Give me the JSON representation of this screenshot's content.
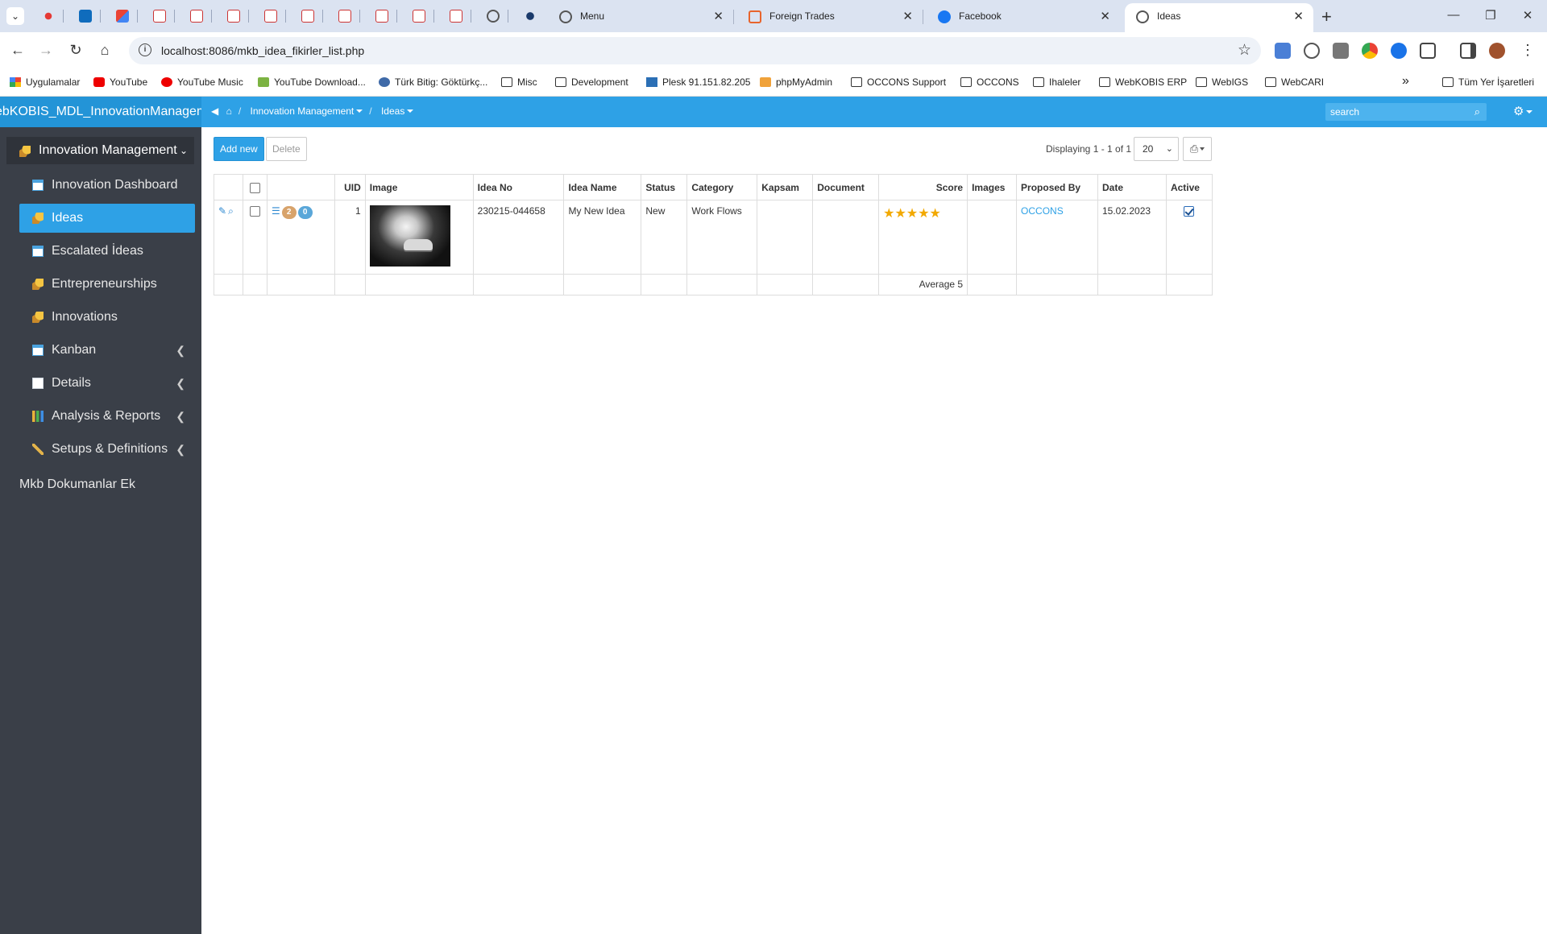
{
  "browser": {
    "tabs": [
      {
        "title": "Menu"
      },
      {
        "title": "Foreign Trades"
      },
      {
        "title": "Facebook"
      },
      {
        "title": "Ideas",
        "active": true
      }
    ],
    "url": "localhost:8086/mkb_idea_fikirler_list.php",
    "bookmarks": [
      {
        "label": "Uygulamalar",
        "icon": "apps-grid-icon"
      },
      {
        "label": "YouTube",
        "icon": "youtube-icon"
      },
      {
        "label": "YouTube Music",
        "icon": "youtube-music-icon"
      },
      {
        "label": "YouTube Download...",
        "icon": "download-icon"
      },
      {
        "label": "Türk Bitig: Göktürkç...",
        "icon": "site-icon"
      },
      {
        "label": "Misc",
        "icon": "folder-icon"
      },
      {
        "label": "Development",
        "icon": "folder-icon"
      },
      {
        "label": "Plesk 91.151.82.205",
        "icon": "plesk-icon"
      },
      {
        "label": "phpMyAdmin",
        "icon": "phpmyadmin-icon"
      },
      {
        "label": "OCCONS Support",
        "icon": "folder-icon"
      },
      {
        "label": "OCCONS",
        "icon": "folder-icon"
      },
      {
        "label": "Ihaleler",
        "icon": "folder-icon"
      },
      {
        "label": "WebKOBIS ERP",
        "icon": "folder-icon"
      },
      {
        "label": "WebIGS",
        "icon": "folder-icon"
      },
      {
        "label": "WebCARI",
        "icon": "folder-icon"
      }
    ],
    "bookmarks_more": "»",
    "all_bookmarks": "Tüm Yer İşaretleri"
  },
  "app": {
    "brand": "ebKOBIS_MDL_InnovationManagement",
    "breadcrumb": {
      "module": "Innovation Management",
      "page": "Ideas"
    },
    "search_placeholder": "search"
  },
  "sidebar": {
    "parent": "Innovation Management",
    "items": [
      {
        "label": "Innovation Dashboard",
        "icon": "grid-icon"
      },
      {
        "label": "Ideas",
        "icon": "rocket-icon",
        "active": true
      },
      {
        "label": "Escalated İdeas",
        "icon": "grid-icon"
      },
      {
        "label": "Entrepreneurships",
        "icon": "rocket-icon"
      },
      {
        "label": "Innovations",
        "icon": "rocket-icon"
      },
      {
        "label": "Kanban",
        "icon": "grid-icon",
        "expandable": true
      },
      {
        "label": "Details",
        "icon": "document-icon",
        "expandable": true
      },
      {
        "label": "Analysis & Reports",
        "icon": "chart-icon",
        "expandable": true
      },
      {
        "label": "Setups & Definitions",
        "icon": "wrench-icon",
        "expandable": true
      }
    ],
    "footer_item": "Mkb Dokumanlar Ek"
  },
  "list": {
    "add_label": "Add new",
    "delete_label": "Delete",
    "display_text": "Displaying 1 - 1 of 1",
    "page_size": "20",
    "columns": [
      "UID",
      "Image",
      "Idea No",
      "Idea Name",
      "Status",
      "Category",
      "Kapsam",
      "Document",
      "Score",
      "Images",
      "Proposed By",
      "Date",
      "Active"
    ],
    "rows": [
      {
        "badge_1": "2",
        "badge_2": "0",
        "uid": "1",
        "idea_no": "230215-044658",
        "idea_name": "My New Idea",
        "status": "New",
        "category": "Work Flows",
        "kapsam": "",
        "document": "",
        "score_stars": 5,
        "images": "",
        "proposed_by": "OCCONS",
        "date": "15.02.2023",
        "active": true
      }
    ],
    "footer": {
      "score_summary": "Average 5"
    }
  }
}
